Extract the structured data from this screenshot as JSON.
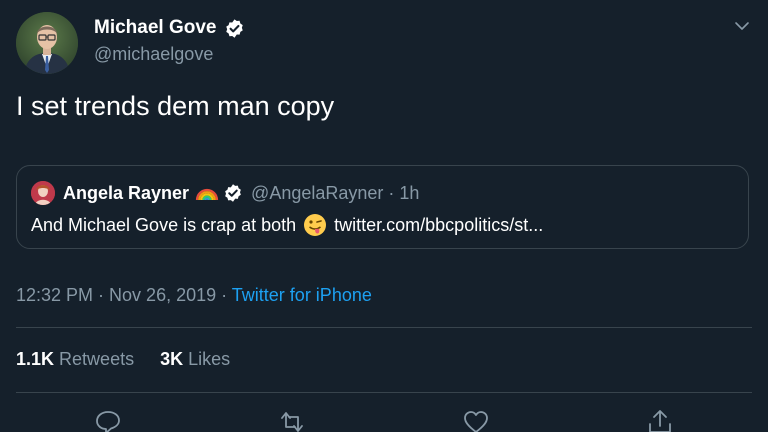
{
  "author": {
    "name": "Michael Gove",
    "handle": "@michaelgove"
  },
  "tweet": {
    "text": "I set trends dem man copy"
  },
  "quoted_tweet": {
    "name": "Angela Rayner",
    "name_emoji": "rainbow",
    "handle": "@AngelaRayner",
    "separator": "·",
    "time": "1h",
    "text_before": "And Michael Gove is crap at both",
    "text_emoji": "winking-face-with-tongue",
    "link_text": "twitter.com/bbcpolitics/st..."
  },
  "meta": {
    "time": "12:32 PM",
    "separator": " · ",
    "date": "Nov 26, 2019",
    "source": "Twitter for iPhone"
  },
  "stats": {
    "retweets_count": "1.1K",
    "retweets_label": "Retweets",
    "likes_count": "3K",
    "likes_label": "Likes"
  },
  "colors": {
    "background": "#15202b",
    "text": "#ffffff",
    "secondary": "#8899a6",
    "link": "#1da1f2",
    "border": "#38444d"
  },
  "icons": [
    "verified-badge-icon",
    "chevron-down-icon",
    "reply-icon",
    "retweet-icon",
    "like-icon",
    "share-icon"
  ]
}
